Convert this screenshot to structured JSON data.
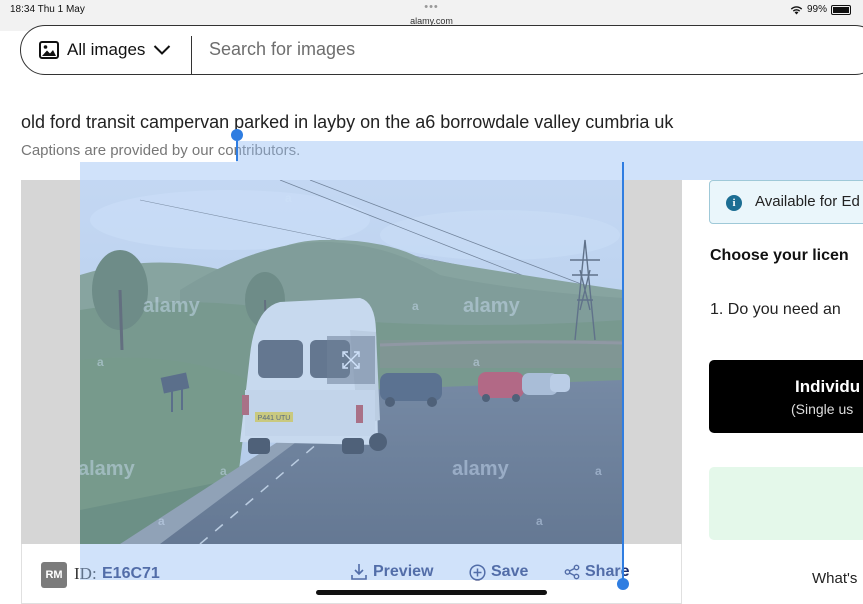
{
  "status_bar": {
    "time": "18:34  Thu 1 May",
    "url": "alamy.com",
    "dots": "•••",
    "battery": "99%",
    "battery_level": 0.99
  },
  "search": {
    "filter_label": "All images",
    "placeholder": "Search for images"
  },
  "caption": {
    "title": "old ford transit campervan parked in layby on the a6 borrowdale valley cumbria uk",
    "subtitle": "Captions are provided by our contributors."
  },
  "image": {
    "watermark": "alamy",
    "watermark_small": "a",
    "number_plate": "P441 UTU"
  },
  "image_footer": {
    "badge": "RM",
    "id_label": "ID:",
    "id_value": "E16C71",
    "preview_label": "Preview",
    "save_label": "Save",
    "share_label": "Share"
  },
  "license_panel": {
    "available_text": "Available for Ed",
    "choose_heading": "Choose your licen",
    "question": "1. Do you need an",
    "individual_title": "Individu",
    "individual_sub": "(Single us",
    "whats_text": "What's"
  },
  "colors": {
    "accent_navy": "#1b2a6b",
    "selection_blue": "#2f7de1",
    "info_blue": "#1c6e93",
    "green_box": "#e4f8ea"
  }
}
